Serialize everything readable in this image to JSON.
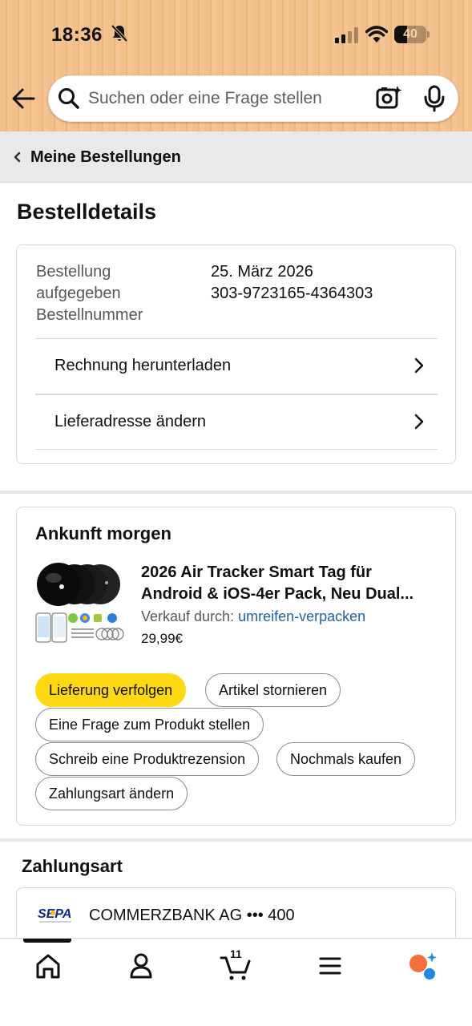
{
  "status_bar": {
    "time": "18:36",
    "battery": "40",
    "battery_level": 0.4
  },
  "search": {
    "placeholder": "Suchen oder eine Frage stellen"
  },
  "breadcrumb": {
    "label": "Meine Bestellungen"
  },
  "page_title": "Bestelldetails",
  "order_info": {
    "labels": [
      "Bestellung",
      "aufgegeben",
      "Bestellnummer"
    ],
    "date": "25. März 2026",
    "number": "303-9723165-4364303",
    "links": [
      {
        "label": "Rechnung herunterladen"
      },
      {
        "label": "Lieferadresse ändern"
      }
    ]
  },
  "shipment": {
    "heading": "Ankunft morgen",
    "product": {
      "title_line1": "2026 Air Tracker Smart Tag für",
      "title_line2": "Android & iOS-4er Pack, Neu Dual...",
      "seller_prefix": "Verkauf durch:",
      "seller": "umreifen-verpacken",
      "price": "29,99€"
    },
    "buttons": [
      {
        "label": "Lieferung verfolgen"
      },
      {
        "label": "Artikel stornieren"
      },
      {
        "label": "Eine Frage zum Produkt stellen"
      },
      {
        "label": "Schreib eine Produktrezension"
      },
      {
        "label": "Nochmals kaufen"
      },
      {
        "label": "Zahlungsart ändern"
      }
    ]
  },
  "payment": {
    "heading": "Zahlungsart",
    "logo_text": "SEPA",
    "method": "COMMERZBANK AG ••• 400"
  },
  "bottom_nav": {
    "cart_count": "11",
    "items": [
      "home-icon",
      "account-icon",
      "cart-icon",
      "menu-icon",
      "rufus-icon"
    ]
  },
  "colors": {
    "header_bg": "#f2c08a",
    "primary_button": "#ffd814",
    "link": "#2162a1",
    "rufus_orange": "#f3703c",
    "rufus_blue": "#1e88e5"
  }
}
